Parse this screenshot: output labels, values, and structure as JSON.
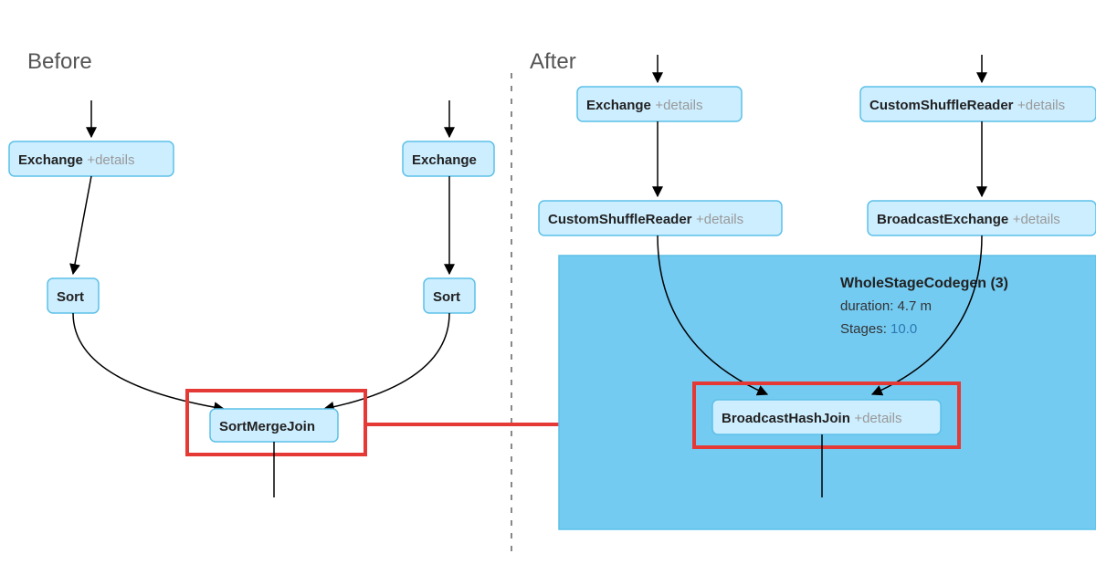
{
  "headings": {
    "before": "Before",
    "after": "After"
  },
  "details_label": "+details",
  "before": {
    "nodes": {
      "exchange_left": "Exchange",
      "exchange_right": "Exchange",
      "sort_left": "Sort",
      "sort_right": "Sort",
      "join": "SortMergeJoin"
    }
  },
  "after": {
    "nodes": {
      "exchange": "Exchange",
      "custom_reader_top": "CustomShuffleReader",
      "custom_reader_left": "CustomShuffleReader",
      "broadcast_exchange": "BroadcastExchange",
      "join": "BroadcastHashJoin"
    },
    "stage": {
      "title": "WholeStageCodegen (3)",
      "duration": "duration: 4.7 m",
      "stages_label": "Stages: ",
      "stages_value": "10.0"
    }
  }
}
